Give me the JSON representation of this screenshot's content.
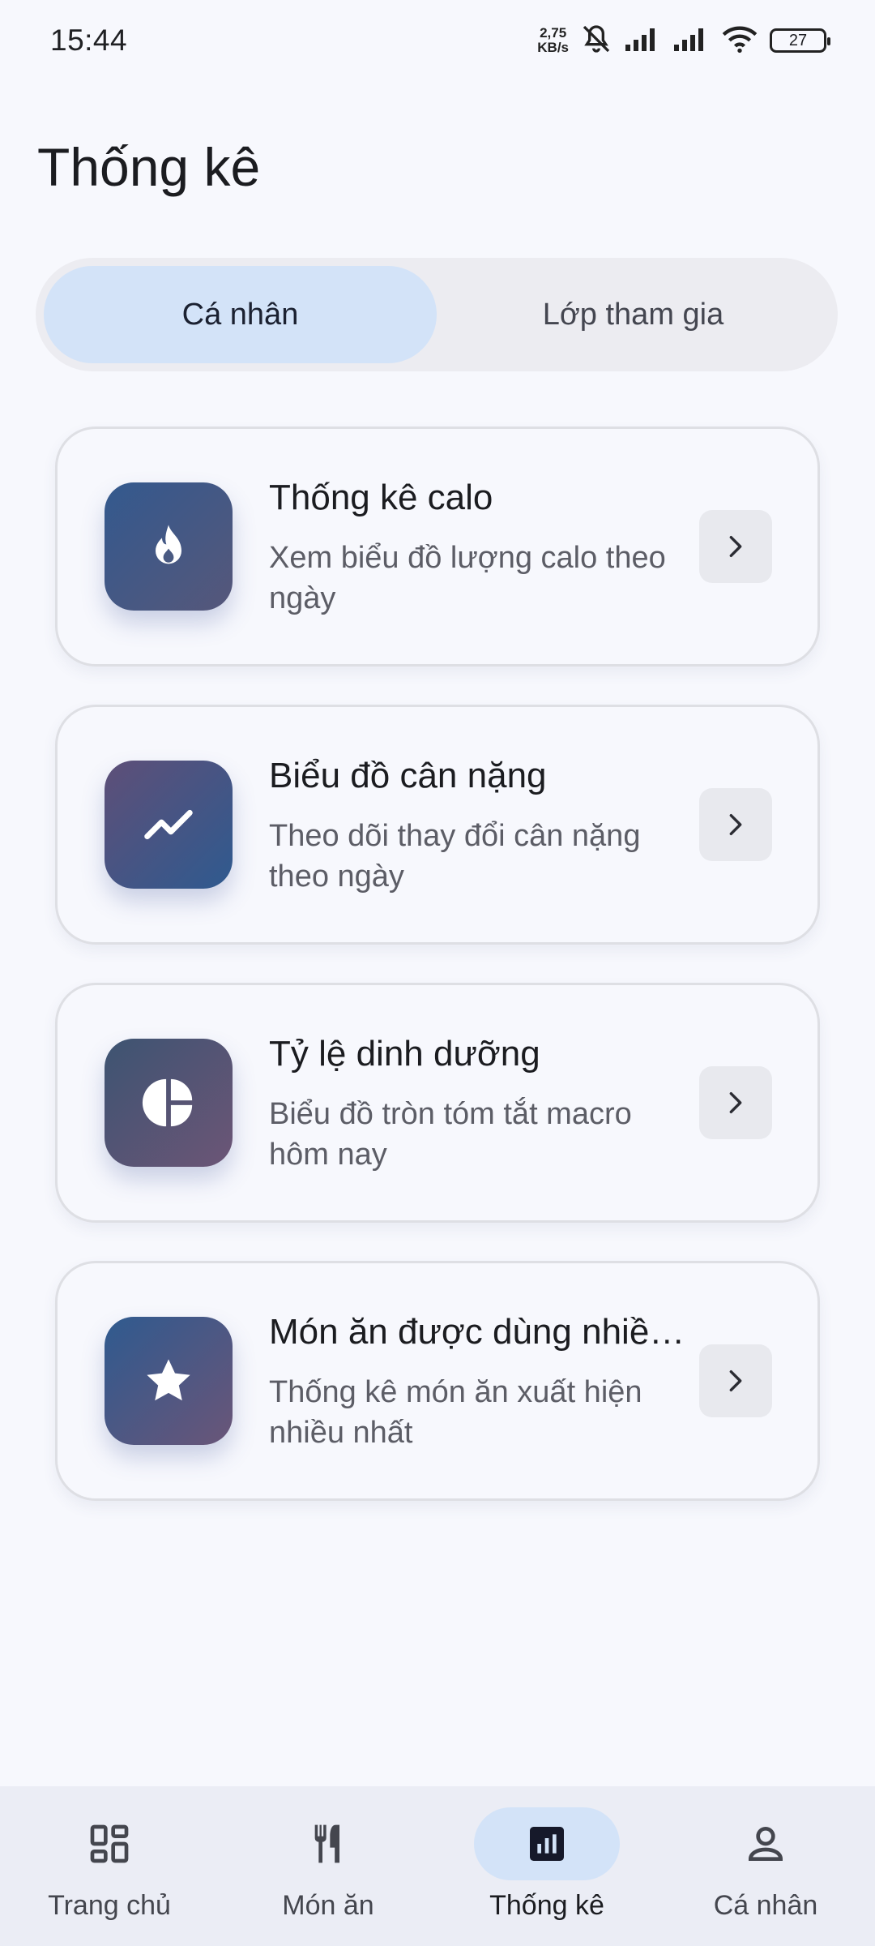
{
  "status_bar": {
    "time": "15:44",
    "net_speed_value": "2,75",
    "net_speed_unit": "KB/s",
    "battery": "27",
    "icons": [
      "mute-bell-icon",
      "signal-icon",
      "signal-icon",
      "wifi-icon",
      "battery-icon"
    ]
  },
  "page": {
    "title": "Thống kê"
  },
  "segment": {
    "tabs": [
      {
        "label": "Cá nhân",
        "active": true
      },
      {
        "label": "Lớp tham gia",
        "active": false
      }
    ]
  },
  "cards": [
    {
      "title": "Thống kê calo",
      "description": "Xem biểu đồ lượng calo theo ngày",
      "icon": "flame-icon",
      "gradient": [
        "#33598e",
        "#56577a"
      ]
    },
    {
      "title": "Biểu đồ cân nặng",
      "description": "Theo dõi thay đổi cân nặng theo ngày",
      "icon": "trend-up-icon",
      "gradient": [
        "#5e4f78",
        "#2f5a8f"
      ]
    },
    {
      "title": "Tỷ lệ dinh dưỡng",
      "description": "Biểu đồ tròn tóm tắt macro hôm nay",
      "icon": "pie-chart-icon",
      "gradient": [
        "#3d5472",
        "#6c5576"
      ]
    },
    {
      "title": "Món ăn được dùng nhiều nhất",
      "description": "Thống kê món ăn xuất hiện nhiều nhất",
      "icon": "star-icon",
      "gradient": [
        "#2f5a8f",
        "#6a5578"
      ]
    }
  ],
  "bottom_nav": {
    "items": [
      {
        "label": "Trang chủ",
        "icon": "dashboard-icon",
        "active": false
      },
      {
        "label": "Món ăn",
        "icon": "utensils-icon",
        "active": false
      },
      {
        "label": "Thống kê",
        "icon": "bar-chart-icon",
        "active": true
      },
      {
        "label": "Cá nhân",
        "icon": "person-icon",
        "active": false
      }
    ]
  }
}
